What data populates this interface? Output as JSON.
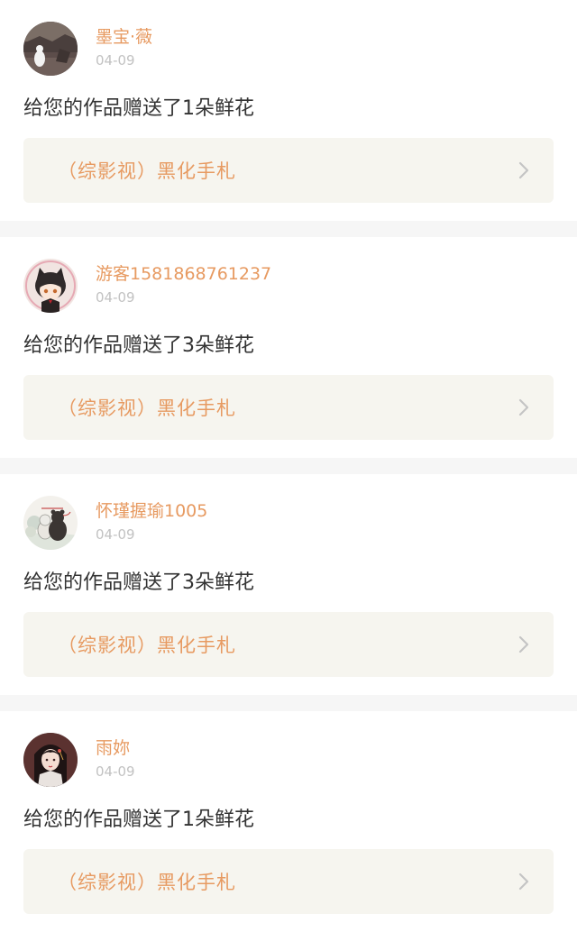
{
  "theme": {
    "accent": "#e79a61",
    "chevron": "#c4c4c4"
  },
  "notifications": [
    {
      "username": "墨宝·薇",
      "date": "04-09",
      "message": "给您的作品赠送了1朵鲜花",
      "work_title": "（综影视）黑化手札",
      "avatar": "avatar-landscape-white-figure"
    },
    {
      "username": "游客1581868761237",
      "date": "04-09",
      "message": "给您的作品赠送了3朵鲜花",
      "work_title": "（综影视）黑化手札",
      "avatar": "avatar-anime-catgirl"
    },
    {
      "username": "怀瑾握瑜1005",
      "date": "04-09",
      "message": "给您的作品赠送了3朵鲜花",
      "work_title": "（综影视）黑化手札",
      "avatar": "avatar-two-bears-sketch"
    },
    {
      "username": "雨妳",
      "date": "04-09",
      "message": "给您的作品赠送了1朵鲜花",
      "work_title": "（综影视）黑化手札",
      "avatar": "avatar-ancient-style-girl"
    }
  ]
}
